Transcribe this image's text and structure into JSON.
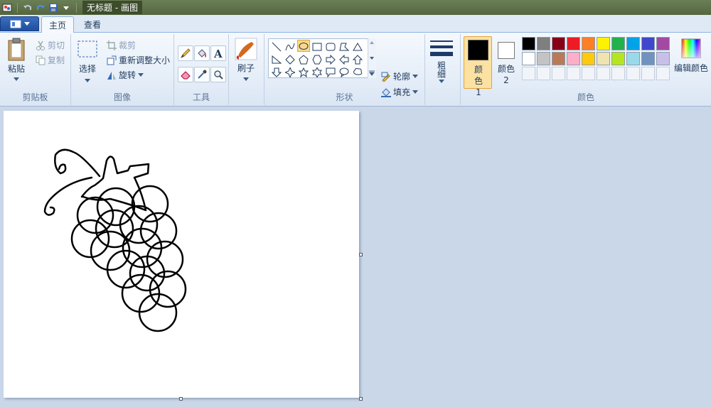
{
  "window": {
    "title": "无标题 - 画图"
  },
  "tabs": [
    {
      "label": "主页",
      "active": true
    },
    {
      "label": "查看",
      "active": false
    }
  ],
  "clipboard": {
    "paste_label": "粘贴",
    "cut_label": "剪切",
    "copy_label": "复制",
    "group_label": "剪贴板"
  },
  "image": {
    "select_label": "选择",
    "crop_label": "裁剪",
    "resize_label": "重新调整大小",
    "rotate_label": "旋转",
    "group_label": "图像"
  },
  "tools": {
    "group_label": "工具",
    "items": [
      "pencil-icon",
      "fill-icon",
      "text-icon",
      "eraser-icon",
      "color-picker-icon",
      "magnifier-icon"
    ]
  },
  "brushes": {
    "label": "刷子"
  },
  "shapes": {
    "group_label": "形状",
    "outline_label": "轮廓",
    "fill_label": "填充",
    "selected": "oval"
  },
  "size": {
    "label": "粗细"
  },
  "colors": {
    "group_label": "颜色",
    "color1_label": "颜色 1",
    "color2_label": "颜色 2",
    "color1": "#000000",
    "color2": "#ffffff",
    "edit_label": "编辑颜色",
    "palette_row1": [
      "#000000",
      "#7f7f7f",
      "#880015",
      "#ed1c24",
      "#ff7f27",
      "#fff200",
      "#22b14c",
      "#00a2e8",
      "#3f48cc",
      "#a349a4"
    ],
    "palette_row2": [
      "#ffffff",
      "#c3c3c3",
      "#b97a57",
      "#ffaec9",
      "#ffc90e",
      "#efe4b0",
      "#b5e61d",
      "#99d9ea",
      "#7092be",
      "#c8bfe7"
    ]
  }
}
